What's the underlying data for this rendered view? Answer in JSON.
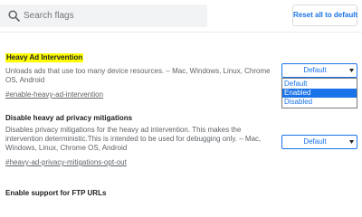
{
  "search": {
    "placeholder": "Search flags",
    "value": ""
  },
  "reset_button_label": "Reset all to default",
  "flags": [
    {
      "title": "Heavy Ad Intervention",
      "description": "Unloads ads that use too many device resources. – Mac, Windows, Linux, Chrome OS, Android",
      "link": "#enable-heavy-ad-intervention",
      "select_value": "Default",
      "dropdown_open": true,
      "options": [
        "Default",
        "Enabled",
        "Disabled"
      ],
      "highlighted_option": "Enabled"
    },
    {
      "title": "Disable heavy ad privacy mitigations",
      "description": "Disables privacy mitigations for the heavy ad intervention. This makes the intervention deterministic.This is intended to be used for debugging only. – Mac, Windows, Linux, Chrome OS, Android",
      "link": "#heavy-ad-privacy-mitigations-opt-out",
      "select_value": "Default"
    },
    {
      "title": "Enable support for FTP URLs"
    }
  ],
  "colors": {
    "accent": "#1a73e8",
    "highlight": "#ffff00",
    "search_bg": "#f1f3f4",
    "muted_text": "#5f6368"
  },
  "icons": {
    "search": "search-icon",
    "caret": "chevron-down-icon"
  }
}
